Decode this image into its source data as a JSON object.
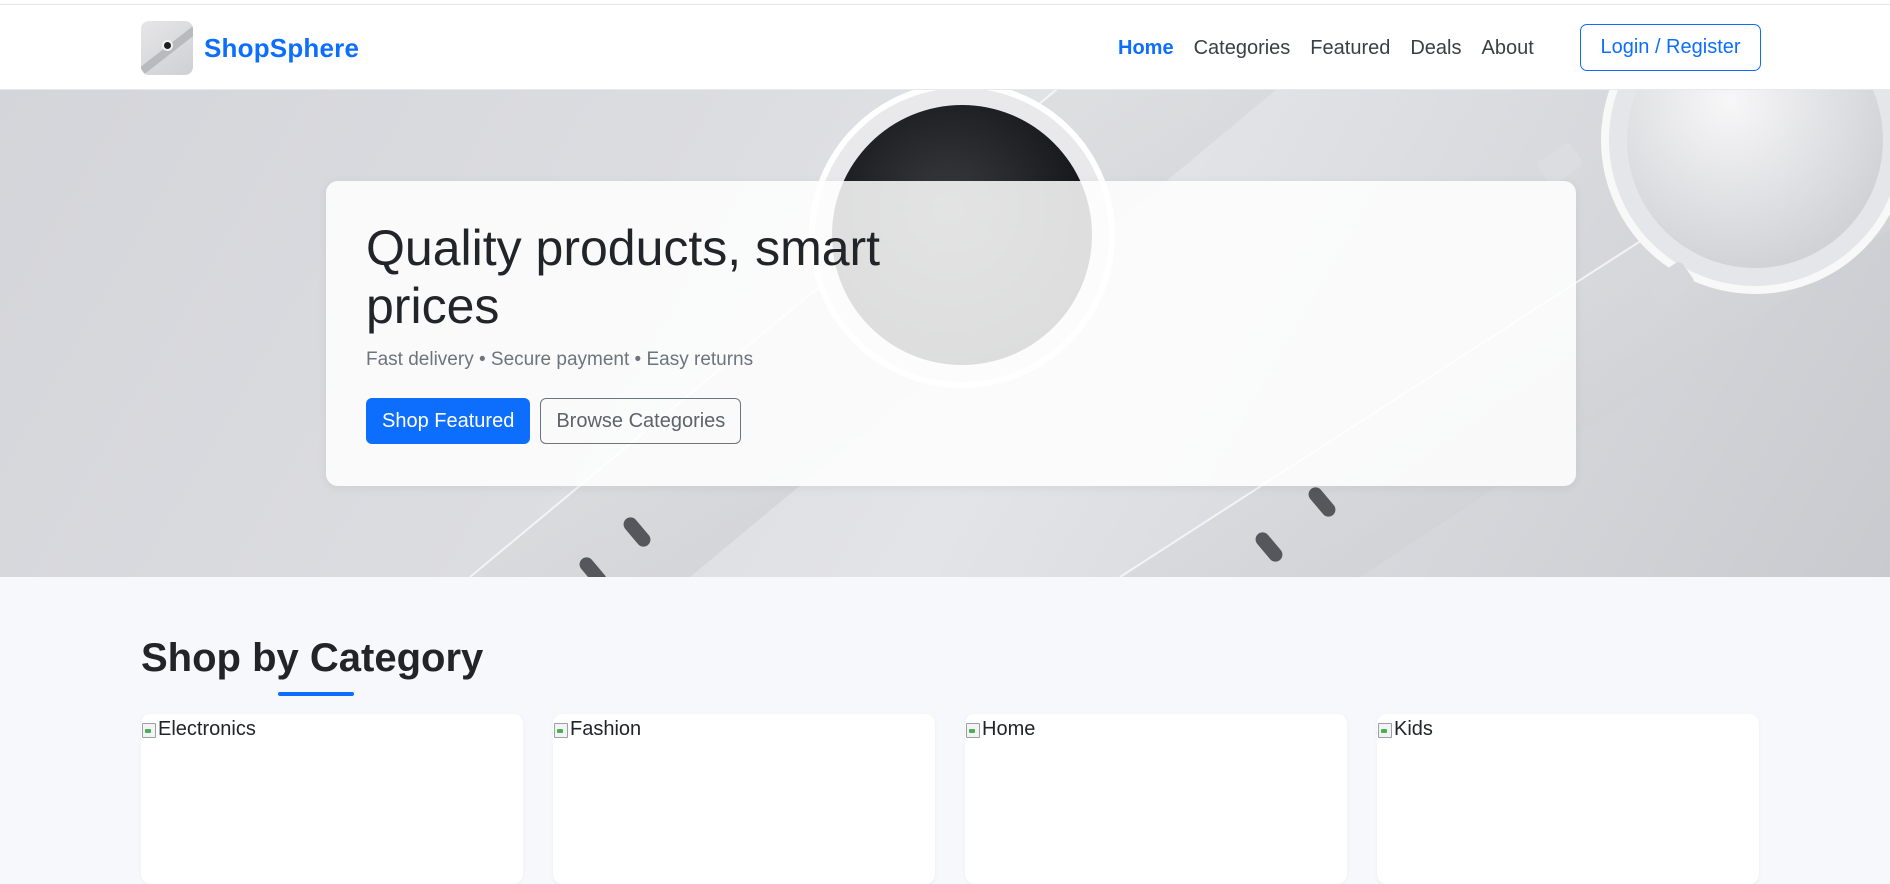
{
  "brand": {
    "name": "ShopSphere",
    "logo_icon": "watch-logo-icon"
  },
  "nav": {
    "links": [
      {
        "label": "Home",
        "active": true
      },
      {
        "label": "Categories",
        "active": false
      },
      {
        "label": "Featured",
        "active": false
      },
      {
        "label": "Deals",
        "active": false
      },
      {
        "label": "About",
        "active": false
      }
    ],
    "login_label": "Login / Register"
  },
  "hero": {
    "title": "Quality products, smart prices",
    "subtitle": "Fast delivery • Secure payment • Easy returns",
    "primary_button": "Shop Featured",
    "secondary_button": "Browse Categories"
  },
  "categories": {
    "title": "Shop by Category",
    "items": [
      {
        "alt": "Electronics"
      },
      {
        "alt": "Fashion"
      },
      {
        "alt": "Home"
      },
      {
        "alt": "Kids"
      }
    ]
  },
  "colors": {
    "accent": "#0d6efd",
    "text": "#212529",
    "muted": "#6c757d",
    "page_bg": "#f6f8fb"
  }
}
